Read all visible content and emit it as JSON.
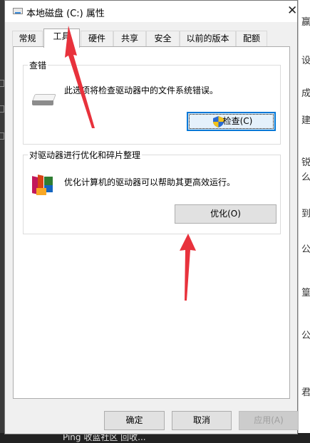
{
  "window": {
    "title": "本地磁盘 (C:) 属性"
  },
  "tabs": [
    {
      "label": "常规",
      "active": false
    },
    {
      "label": "工具",
      "active": true
    },
    {
      "label": "硬件",
      "active": false
    },
    {
      "label": "共享",
      "active": false
    },
    {
      "label": "安全",
      "active": false
    },
    {
      "label": "以前的版本",
      "active": false
    },
    {
      "label": "配额",
      "active": false
    }
  ],
  "check_group": {
    "title": "查错",
    "description": "此选项将检查驱动器中的文件系统错误。",
    "button_label": "检查(C)"
  },
  "optimize_group": {
    "title": "对驱动器进行优化和碎片整理",
    "description": "优化计算机的驱动器可以帮助其更高效运行。",
    "button_label": "优化(O)"
  },
  "footer": {
    "ok_label": "确定",
    "cancel_label": "取消",
    "apply_label": "应用(A)"
  },
  "background": {
    "right_fragments": [
      "赢",
      "设",
      "成",
      "建",
      "锐",
      "么",
      "到",
      "公",
      "篁",
      "公",
      "君"
    ],
    "bottom_text": "Ping 收蓝社区 回收..."
  },
  "annotation_color": "#e8323c"
}
